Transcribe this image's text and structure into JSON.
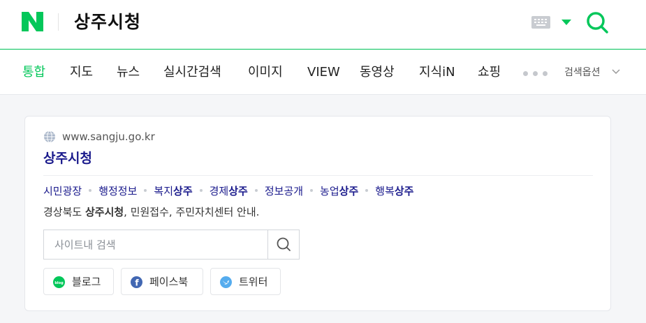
{
  "header": {
    "logo_letter": "N",
    "query": "상주시청",
    "brand_color": "#03c75a"
  },
  "tabs": [
    {
      "label": "통합",
      "active": true
    },
    {
      "label": "지도"
    },
    {
      "label": "뉴스"
    },
    {
      "label": "실시간검색"
    },
    {
      "label": "이미지"
    },
    {
      "label": "VIEW"
    },
    {
      "label": "동영상"
    },
    {
      "label": "지식iN"
    },
    {
      "label": "쇼핑"
    }
  ],
  "search_options_label": "검색옵션",
  "result": {
    "url": "www.sangju.go.kr",
    "title": "상주시청",
    "sublinks": [
      {
        "pre": "시민광장",
        "bold": ""
      },
      {
        "pre": "행정정보",
        "bold": ""
      },
      {
        "pre": "복지",
        "bold": "상주"
      },
      {
        "pre": "경제",
        "bold": "상주"
      },
      {
        "pre": "정보공개",
        "bold": ""
      },
      {
        "pre": "농업",
        "bold": "상주"
      },
      {
        "pre": "행복",
        "bold": "상주"
      }
    ],
    "description": {
      "pre": "경상북도 ",
      "bold": "상주시청",
      "post": ", 민원접수, 주민자치센터 안내."
    },
    "site_search": {
      "placeholder": "사이트내 검색",
      "value": ""
    },
    "social": [
      {
        "label": "블로그",
        "icon": "blog-icon",
        "color": "#03c75a"
      },
      {
        "label": "페이스북",
        "icon": "facebook-icon",
        "color": "#4267b2"
      },
      {
        "label": "트위터",
        "icon": "twitter-icon",
        "color": "#55acee"
      }
    ]
  }
}
